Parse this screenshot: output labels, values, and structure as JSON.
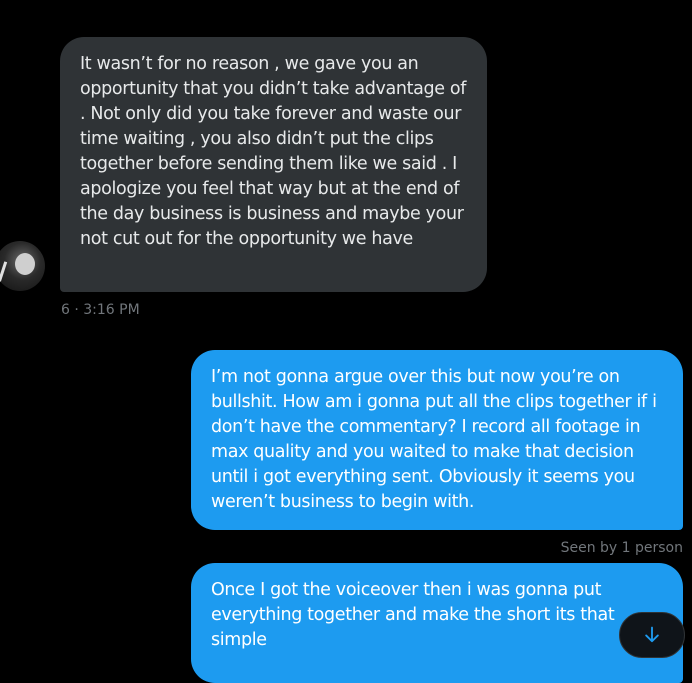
{
  "conversation": {
    "messages": [
      {
        "direction": "incoming",
        "text": "It wasn’t for no reason , we gave you an opportunity that you didn’t take advantage of . Not only did you take forever and waste our time waiting , you also didn’t put the clips together before sending them like we said . I apologize you feel that way but at the end of the day business is business and maybe your not cut out for the opportunity we have",
        "meta": "6 · 3:16 PM"
      },
      {
        "direction": "outgoing",
        "text": "I’m not gonna argue over this but now you’re on bullshit. How am i gonna put all the clips together if i don’t have the commentary? I record all footage in max quality and you waited to make that decision until i got everything sent. Obviously it seems you weren’t business to begin with.",
        "meta": "Seen by 1 person"
      },
      {
        "direction": "outgoing",
        "text": "Once I got the voiceover then i was gonna put everything together and make the short its that simple"
      }
    ]
  },
  "scroll_button": {
    "icon": "arrow-down-icon"
  },
  "colors": {
    "background": "#000000",
    "incoming_bubble": "#2f3336",
    "outgoing_bubble": "#1d9bf0",
    "meta_text": "#71767b"
  }
}
